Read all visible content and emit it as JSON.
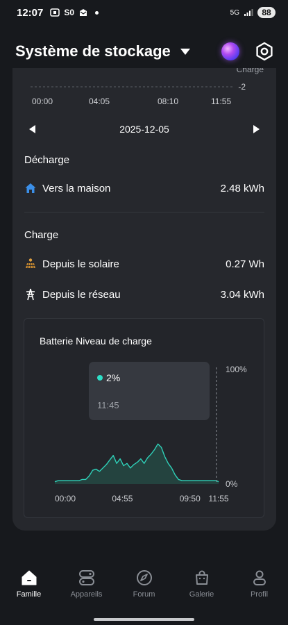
{
  "status_bar": {
    "time": "12:07",
    "left_icons_text": "S0",
    "network": "5G",
    "battery": "88"
  },
  "header": {
    "title": "Système de stockage"
  },
  "top_chart": {
    "legend": "Charge",
    "y_tick": "-2",
    "x_ticks": [
      "00:00",
      "04:05",
      "08:10",
      "11:55"
    ]
  },
  "date_nav": {
    "date": "2025-12-05"
  },
  "decharge": {
    "title": "Décharge",
    "rows": [
      {
        "label": "Vers la maison",
        "value": "2.48 kWh",
        "icon": "home-icon"
      }
    ]
  },
  "charge": {
    "title": "Charge",
    "rows": [
      {
        "label": "Depuis le solaire",
        "value": "0.27 Wh",
        "icon": "solar-panel-icon"
      },
      {
        "label": "Depuis le réseau",
        "value": "3.04 kWh",
        "icon": "power-tower-icon"
      }
    ]
  },
  "battery_panel": {
    "title": "Batterie Niveau de charge",
    "tooltip": {
      "value": "2%",
      "time": "11:45"
    }
  },
  "chart_data": {
    "type": "area",
    "title": "Batterie Niveau de charge",
    "ylabel": "",
    "xlabel": "",
    "ylim": [
      0,
      100
    ],
    "y_tick_labels": [
      "100%",
      "0%"
    ],
    "x_tick_labels": [
      "00:00",
      "04:55",
      "09:50",
      "11:55"
    ],
    "x_minutes": [
      0,
      15,
      30,
      45,
      60,
      75,
      90,
      105,
      120,
      135,
      150,
      165,
      180,
      195,
      210,
      225,
      240,
      255,
      270,
      285,
      300,
      315,
      330,
      345,
      360,
      375,
      390,
      405,
      420,
      435,
      450,
      465,
      480,
      495,
      510,
      525,
      540,
      555,
      570,
      585,
      600,
      615,
      630,
      645,
      660,
      675,
      690,
      705,
      715
    ],
    "series": [
      {
        "values": [
          2,
          3,
          3,
          3,
          3,
          3,
          3,
          3,
          4,
          4,
          7,
          12,
          13,
          11,
          14,
          17,
          21,
          25,
          18,
          22,
          16,
          18,
          14,
          17,
          19,
          22,
          18,
          23,
          26,
          30,
          35,
          32,
          24,
          18,
          14,
          8,
          4,
          3,
          3,
          3,
          3,
          3,
          3,
          3,
          3,
          3,
          3,
          3,
          2
        ]
      }
    ],
    "colors": {
      "line": "#2fd0b8",
      "fill": "#24433f"
    },
    "cursor_x_minutes": 705,
    "grid": false
  },
  "nav": {
    "items": [
      {
        "label": "Famille",
        "icon": "house-icon",
        "active": true
      },
      {
        "label": "Appareils",
        "icon": "devices-icon",
        "active": false
      },
      {
        "label": "Forum",
        "icon": "compass-icon",
        "active": false
      },
      {
        "label": "Galerie",
        "icon": "bag-icon",
        "active": false
      },
      {
        "label": "Profil",
        "icon": "person-icon",
        "active": false
      }
    ]
  },
  "colors": {
    "background": "#17191d",
    "card": "#26282d",
    "accent": "#2ee0c8",
    "home_icon": "#3b8fe8",
    "solar_icon": "#e0a040"
  }
}
